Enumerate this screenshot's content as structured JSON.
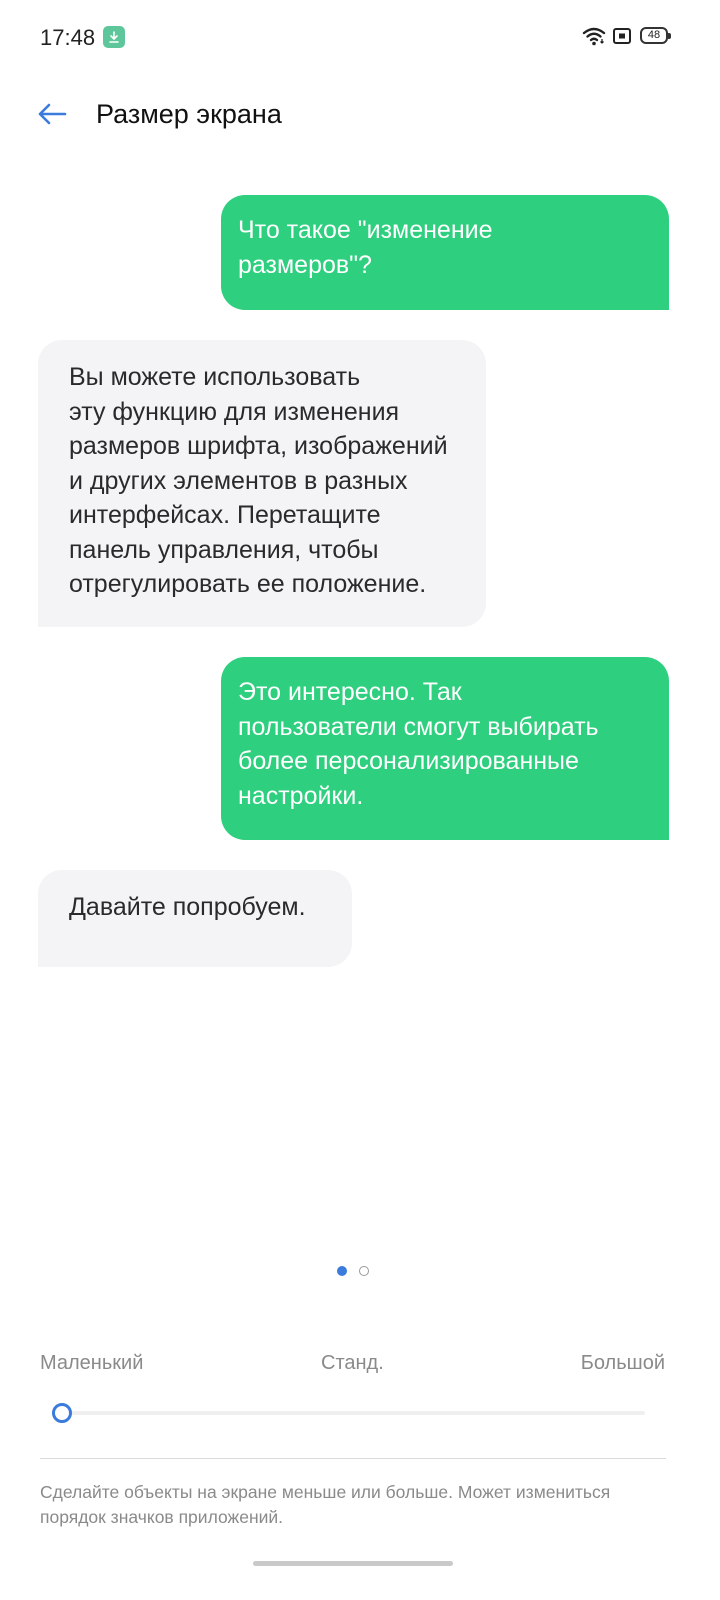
{
  "status_bar": {
    "time": "17:48",
    "battery": "48",
    "icons": [
      "download-icon",
      "wifi-icon",
      "sim-icon",
      "battery-icon"
    ]
  },
  "header": {
    "title": "Размер экрана",
    "back_icon": "arrow-left-icon"
  },
  "chat": [
    {
      "side": "out",
      "text": "Что такое \"изменение\nразмеров\"?"
    },
    {
      "side": "in",
      "text": "Вы можете использовать\nэту функцию для изменения\nразмеров шрифта, изображений\nи других элементов в разных\nинтерфейсах. Перетащите\nпанель управления, чтобы\nотрегулировать ее положение."
    },
    {
      "side": "out",
      "text": "Это интересно. Так\nпользователи смогут выбирать\nболее персонализированные\nнастройки."
    },
    {
      "side": "in",
      "text": "Давайте попробуем."
    }
  ],
  "pager": {
    "count": 2,
    "active": 0
  },
  "size_slider": {
    "labels": {
      "small": "Маленький",
      "standard": "Станд.",
      "large": "Большой"
    },
    "value_fraction": 0.0
  },
  "description": "Сделайте объекты на экране меньше или больше. Может измениться порядок значков приложений.",
  "colors": {
    "accent": "#3a7bdc",
    "outgoing_bubble": "#2ecf7e",
    "incoming_bubble": "#f4f4f6"
  }
}
